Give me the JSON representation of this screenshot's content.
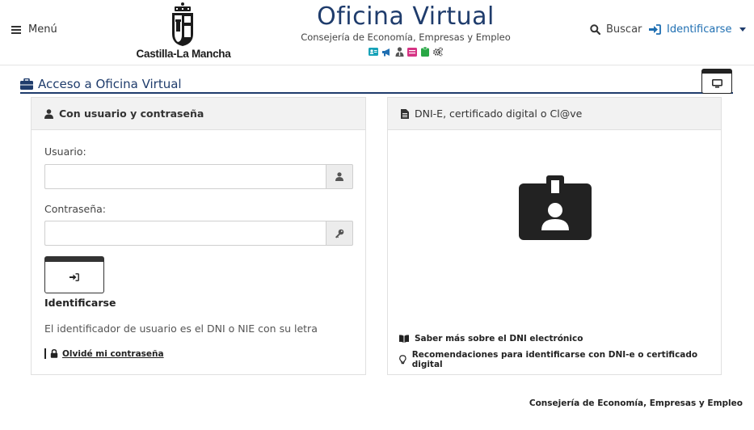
{
  "header": {
    "menu_label": "Menú",
    "logo_text": "Castilla-La Mancha",
    "brand_title": "Oficina Virtual",
    "brand_subtitle": "Consejería de Economía, Empresas y Empleo",
    "brand_icons": [
      {
        "name": "id-card-icon",
        "color": "#17a2b8"
      },
      {
        "name": "megaphone-icon",
        "color": "#1f6fb2"
      },
      {
        "name": "user-tie-icon",
        "color": "#555555"
      },
      {
        "name": "inbox-icon",
        "color": "#d63384"
      },
      {
        "name": "clipboard-icon",
        "color": "#28a745"
      },
      {
        "name": "cogs-icon",
        "color": "#333333"
      }
    ],
    "search_label": "Buscar",
    "login_label": "Identificarse"
  },
  "section": {
    "title": "Acceso a Oficina Virtual"
  },
  "left_panel": {
    "title": "Con usuario y contraseña",
    "user_label": "Usuario:",
    "user_value": "",
    "password_label": "Contraseña:",
    "password_value": "",
    "submit_label": "Identificarse",
    "hint": "El identificador de usuario es el DNI o NIE con su letra",
    "forgot_label": "Olvidé mi contraseña"
  },
  "right_panel": {
    "title": "DNI-E, certificado digital o Cl@ve",
    "links": [
      {
        "label": "Saber más sobre el DNI electrónico",
        "icon": "book-icon"
      },
      {
        "label": "Recomendaciones para identificarse con DNI-e o certificado digital",
        "icon": "lightbulb-icon"
      }
    ]
  },
  "footer": {
    "text": "Consejería de Economía, Empresas y Empleo"
  },
  "colors": {
    "brand": "#1f3c6c",
    "link": "#1f6fb2",
    "panel_header": "#f2f2f2"
  }
}
